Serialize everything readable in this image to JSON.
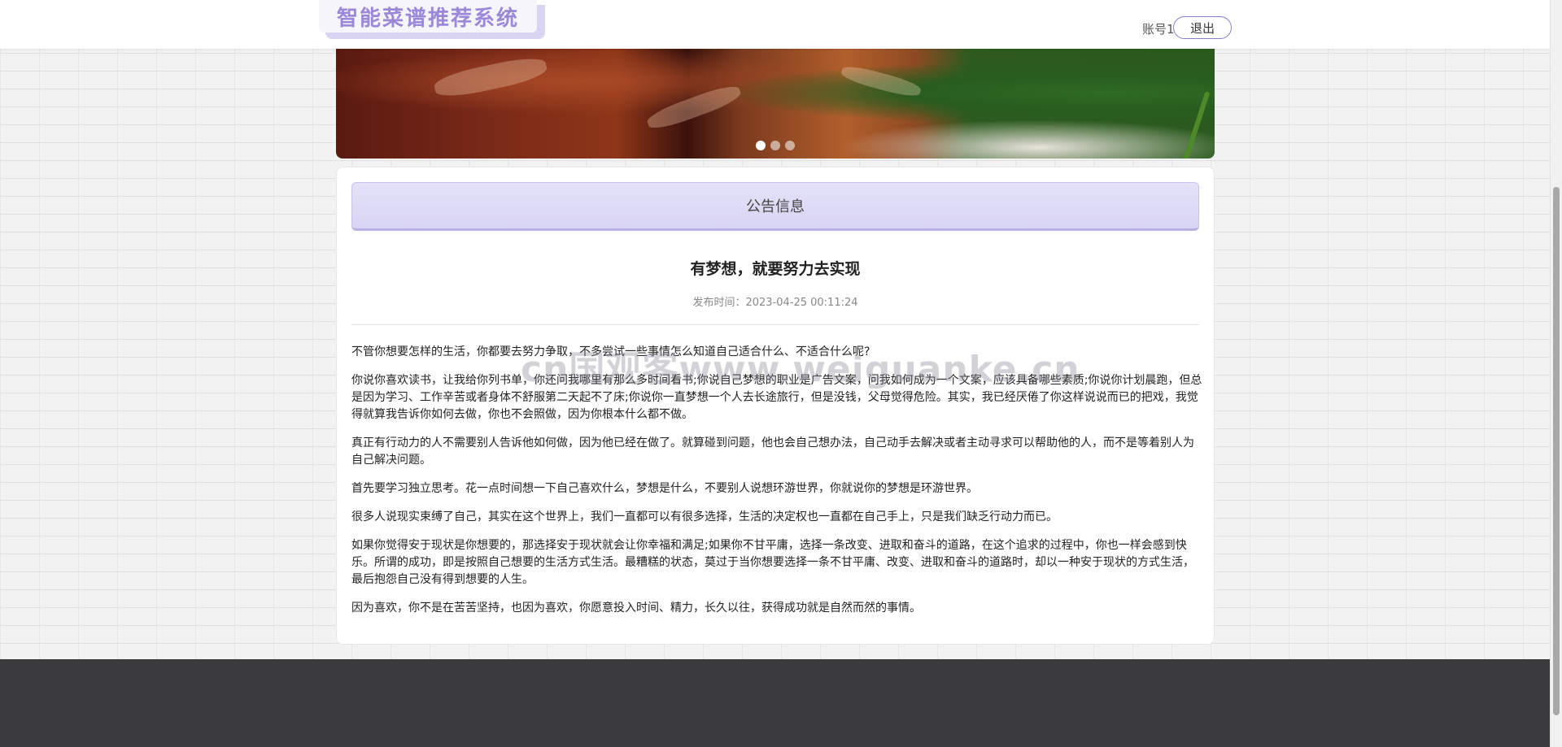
{
  "header": {
    "title": "智能菜谱推荐系统",
    "account": "账号1",
    "logout_label": "退出"
  },
  "banner": {
    "slides": 3,
    "active_slide": 1
  },
  "notice": {
    "section_title": "公告信息",
    "article_title": "有梦想，就要努力去实现",
    "publish_time": "发布时间：2023-04-25 00:11:24",
    "paragraphs": [
      "不管你想要怎样的生活，你都要去努力争取，不多尝试一些事情怎么知道自己适合什么、不适合什么呢?",
      "你说你喜欢读书，让我给你列书单，你还问我哪里有那么多时间看书;你说自己梦想的职业是广告文案，问我如何成为一个文案，应该具备哪些素质;你说你计划晨跑，但总是因为学习、工作辛苦或者身体不舒服第二天起不了床;你说你一直梦想一个人去长途旅行，但是没钱，父母觉得危险。其实，我已经厌倦了你这样说说而已的把戏，我觉得就算我告诉你如何去做，你也不会照做，因为你根本什么都不做。",
      "真正有行动力的人不需要别人告诉他如何做，因为他已经在做了。就算碰到问题，他也会自己想办法，自己动手去解决或者主动寻求可以帮助他的人，而不是等着别人为自己解决问题。",
      "首先要学习独立思考。花一点时间想一下自己喜欢什么，梦想是什么，不要别人说想环游世界，你就说你的梦想是环游世界。",
      "很多人说现实束缚了自己，其实在这个世界上，我们一直都可以有很多选择，生活的决定权也一直都在自己手上，只是我们缺乏行动力而已。",
      "如果你觉得安于现状是你想要的，那选择安于现状就会让你幸福和满足;如果你不甘平庸，选择一条改变、进取和奋斗的道路，在这个追求的过程中，你也一样会感到快乐。所谓的成功，即是按照自己想要的生活方式生活。最糟糕的状态，莫过于当你想要选择一条不甘平庸、改变、进取和奋斗的道路时，却以一种安于现状的方式生活，最后抱怨自己没有得到想要的人生。",
      "因为喜欢，你不是在苦苦坚持，也因为喜欢，你愿意投入时间、精力，长久以往，获得成功就是自然而然的事情。"
    ]
  },
  "watermark": "cn国观客www.weiguanke.cn"
}
